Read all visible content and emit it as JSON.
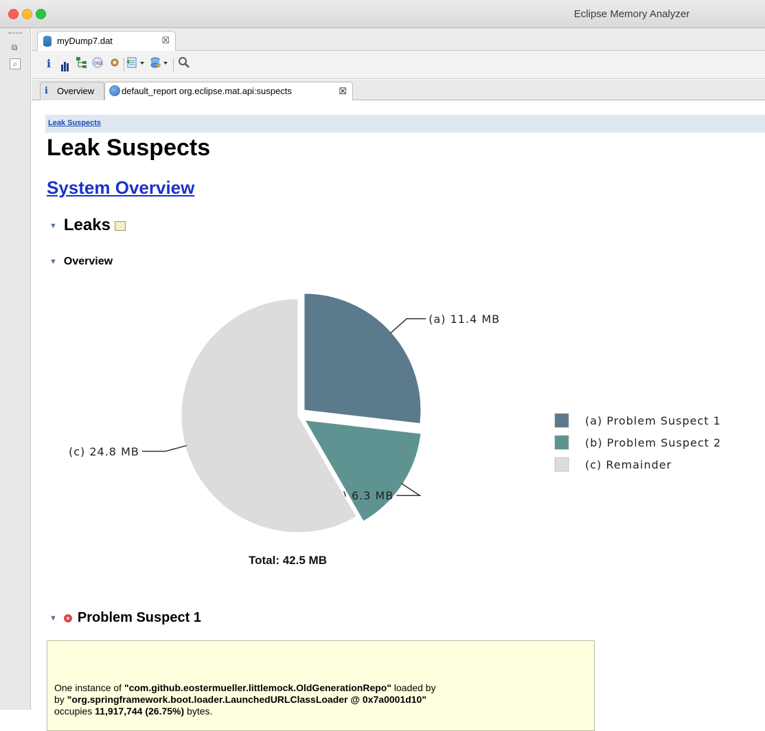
{
  "window": {
    "title": "Eclipse Memory Analyzer"
  },
  "editor_tab": {
    "label": "myDump7.dat",
    "close": "☒"
  },
  "inner_tabs": [
    {
      "label": "Overview"
    },
    {
      "label": "default_report  org.eclipse.mat.api:suspects",
      "close": "☒"
    }
  ],
  "breadcrumb": "Leak Suspects",
  "page_title": "Leak Suspects",
  "system_overview_link": "System Overview",
  "leaks_heading": "Leaks",
  "overview_heading": "Overview",
  "chart_data": {
    "type": "pie",
    "slices": [
      {
        "key": "(a)",
        "value": 11.4,
        "label": "(a)  11.4 MB",
        "legend": "(a)  Problem Suspect 1",
        "color": "#5b7a8c"
      },
      {
        "key": "(b)",
        "value": 6.3,
        "label": "(b)  6.3 MB",
        "legend": "(b)  Problem Suspect 2",
        "color": "#5e9391"
      },
      {
        "key": "(c)",
        "value": 24.8,
        "label": "(c)  24.8 MB",
        "legend": "(c)  Remainder",
        "color": "#dcdcdc"
      }
    ],
    "total_label": "Total: 42.5 MB",
    "legend_position": "right",
    "exploded": [
      "(a)",
      "(b)"
    ]
  },
  "problem_suspect": {
    "title": "Problem Suspect 1",
    "prefix": "One instance of ",
    "class_name": "\"com.github.eostermueller.littlemock.OldGenerationRepo\"",
    "loaded_by_text": " loaded by ",
    "loader": "\"org.springframework.boot.loader.LaunchedURLClassLoader @ 0x7a0001d10\"",
    "occupies_text": "occupies ",
    "bytes_value": "11,917,744 (26.75%)",
    "bytes_suffix": " bytes."
  }
}
